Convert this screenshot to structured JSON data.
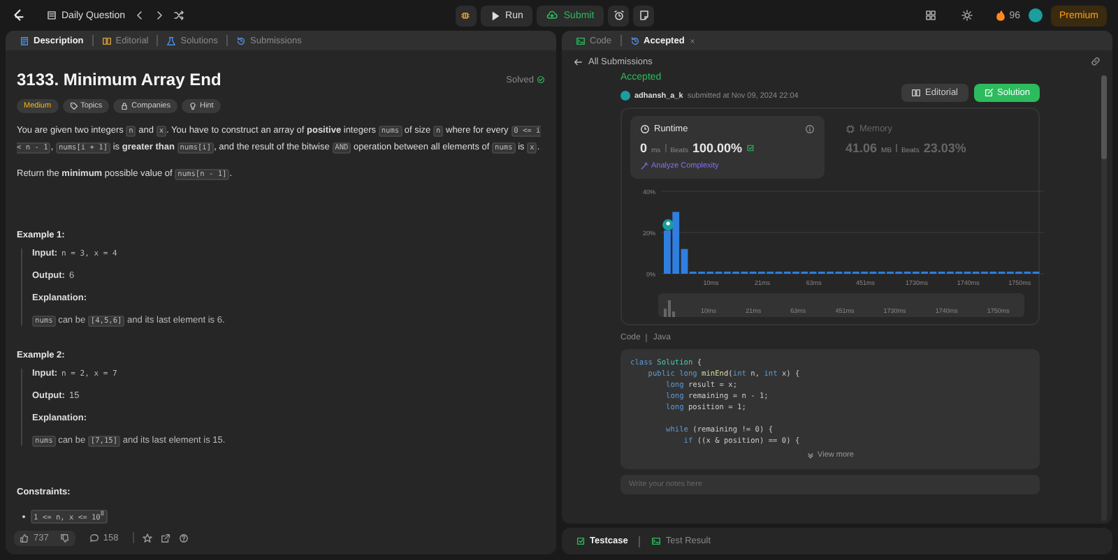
{
  "top_bar": {
    "nav_label": "Daily Question",
    "run_label": "Run",
    "submit_label": "Submit",
    "streak": "96",
    "premium_label": "Premium"
  },
  "left_tabs": [
    {
      "label": "Description",
      "selected": true
    },
    {
      "label": "Editorial",
      "selected": false
    },
    {
      "label": "Solutions",
      "selected": false
    },
    {
      "label": "Submissions",
      "selected": false
    }
  ],
  "problem": {
    "title": "3133. Minimum Array End",
    "status": "Solved",
    "tags": [
      {
        "label": "Medium",
        "kind": "difficulty"
      },
      {
        "label": "Topics",
        "kind": "topics"
      },
      {
        "label": "Companies",
        "kind": "companies"
      },
      {
        "label": "Hint",
        "kind": "hint"
      }
    ],
    "paragraphs": [
      [
        {
          "kind": "text",
          "text": "You are given two integers "
        },
        {
          "kind": "code",
          "text": "n"
        },
        {
          "kind": "text",
          "text": " and "
        },
        {
          "kind": "code",
          "text": "x"
        },
        {
          "kind": "text",
          "text": ". You have to construct an array of "
        },
        {
          "kind": "bold",
          "text": "positive"
        },
        {
          "kind": "text",
          "text": " integers "
        },
        {
          "kind": "code",
          "text": "nums"
        },
        {
          "kind": "text",
          "text": " of size "
        },
        {
          "kind": "code",
          "text": "n"
        },
        {
          "kind": "text",
          "text": " where for every "
        },
        {
          "kind": "code",
          "text": "0 <= i < n - 1"
        },
        {
          "kind": "text",
          "text": ", "
        },
        {
          "kind": "code",
          "text": "nums[i + 1]"
        },
        {
          "kind": "text",
          "text": " is "
        },
        {
          "kind": "bold",
          "text": "greater than "
        },
        {
          "kind": "code",
          "text": "nums[i]"
        },
        {
          "kind": "text",
          "text": ", and the result of the bitwise "
        },
        {
          "kind": "code",
          "text": "AND"
        },
        {
          "kind": "text",
          "text": " operation between all elements of "
        },
        {
          "kind": "code",
          "text": "nums"
        },
        {
          "kind": "text",
          "text": " is "
        },
        {
          "kind": "code",
          "text": "x"
        },
        {
          "kind": "text",
          "text": "."
        }
      ],
      [
        {
          "kind": "text",
          "text": "Return the "
        },
        {
          "kind": "bold",
          "text": "minimum"
        },
        {
          "kind": "text",
          "text": " possible value of "
        },
        {
          "kind": "code",
          "text": "nums[n - 1]"
        },
        {
          "kind": "text",
          "text": "."
        }
      ]
    ],
    "examples": [
      {
        "title": "Example 1:",
        "input_label": "Input:",
        "input": "n = 3, x = 4",
        "output_label": "Output:",
        "output": "6",
        "explanation_label": "Explanation:",
        "explanation": [
          {
            "kind": "code",
            "text": "nums"
          },
          {
            "kind": "text",
            "text": " can be "
          },
          {
            "kind": "code",
            "text": "[4,5,6]"
          },
          {
            "kind": "text",
            "text": " and its last element is 6."
          }
        ]
      },
      {
        "title": "Example 2:",
        "input_label": "Input:",
        "input": "n = 2, x = 7",
        "output_label": "Output:",
        "output": "15",
        "explanation_label": "Explanation:",
        "explanation": [
          {
            "kind": "code",
            "text": "nums"
          },
          {
            "kind": "text",
            "text": " can be "
          },
          {
            "kind": "code",
            "text": "[7,15]"
          },
          {
            "kind": "text",
            "text": " and its last element is 15."
          }
        ]
      }
    ],
    "constraints_title": "Constraints:",
    "constraints": [
      "1 <= n, x <= 10$^{8}$"
    ]
  },
  "left_footer": {
    "likes": "737",
    "comments": "158"
  },
  "right_tabs": [
    {
      "label": "Code",
      "selected": false,
      "closable": false
    },
    {
      "label": "Accepted",
      "selected": true,
      "closable": true
    }
  ],
  "submission": {
    "back_label": "All Submissions",
    "status": "Accepted",
    "user": "adhansh_a_k",
    "submitted": "submitted at Nov 09, 2024 22:04",
    "editorial_button": "Editorial",
    "solution_button": "Solution",
    "metrics": [
      {
        "kind": "runtime",
        "label": "Runtime",
        "value": "0",
        "unit": "ms",
        "beats_label": "Beats",
        "beats": "100.00%",
        "selected": true,
        "link": "Analyze Complexity"
      },
      {
        "kind": "memory",
        "label": "Memory",
        "value": "41.06",
        "unit": "MB",
        "beats_label": "Beats",
        "beats": "23.03%",
        "selected": false
      }
    ],
    "chart_data": {
      "type": "bar",
      "categories": [
        null,
        null,
        null,
        null,
        null,
        "10ms",
        null,
        null,
        null,
        null,
        null,
        "21ms",
        null,
        null,
        null,
        null,
        null,
        "63ms",
        null,
        null,
        null,
        null,
        null,
        "451ms",
        null,
        null,
        null,
        null,
        null,
        "1730ms",
        null,
        null,
        null,
        null,
        null,
        "1740ms",
        null,
        null,
        null,
        null,
        null,
        "1750ms",
        null,
        null
      ],
      "values": [
        21,
        30,
        12,
        1,
        1,
        1,
        1,
        1,
        1,
        1,
        1,
        1,
        1,
        1,
        1,
        1,
        1,
        1,
        1,
        1,
        1,
        1,
        1,
        1,
        1,
        1,
        1,
        1,
        1,
        1,
        1,
        1,
        1,
        1,
        1,
        1,
        1,
        1,
        1,
        1,
        1,
        1,
        1,
        1
      ],
      "ylim": [
        0,
        40
      ],
      "yticks": [
        {
          "value": 0,
          "label": "0%"
        },
        {
          "value": 20,
          "label": "20%"
        },
        {
          "value": 40,
          "label": "40%"
        }
      ]
    },
    "overview_labels": [
      "10ms",
      "21ms",
      "63ms",
      "451ms",
      "1730ms",
      "1740ms",
      "1750ms"
    ],
    "code_label": "Code",
    "language": "Java",
    "code_lines": [
      {
        "gap_before": false,
        "tokens": [
          {
            "kind": "keyword",
            "text": "class "
          },
          {
            "kind": "type",
            "text": "Solution"
          },
          {
            "kind": "plain",
            "text": " {"
          }
        ]
      },
      {
        "gap_before": false,
        "tokens": [
          {
            "kind": "keyword",
            "text": "    public long "
          },
          {
            "kind": "function",
            "text": "minEnd"
          },
          {
            "kind": "plain",
            "text": "("
          },
          {
            "kind": "keyword",
            "text": "int "
          },
          {
            "kind": "plain",
            "text": "n, "
          },
          {
            "kind": "keyword",
            "text": "int "
          },
          {
            "kind": "plain",
            "text": "x) {"
          }
        ]
      },
      {
        "gap_before": false,
        "tokens": [
          {
            "kind": "keyword",
            "text": "        long "
          },
          {
            "kind": "plain",
            "text": "result = x;"
          }
        ]
      },
      {
        "gap_before": false,
        "tokens": [
          {
            "kind": "keyword",
            "text": "        long "
          },
          {
            "kind": "plain",
            "text": "remaining = n - 1;"
          }
        ]
      },
      {
        "gap_before": false,
        "tokens": [
          {
            "kind": "keyword",
            "text": "        long "
          },
          {
            "kind": "plain",
            "text": "position = 1;"
          }
        ]
      },
      {
        "gap_before": true,
        "tokens": [
          {
            "kind": "keyword",
            "text": "        while "
          },
          {
            "kind": "plain",
            "text": "(remaining != 0) {"
          }
        ]
      },
      {
        "gap_before": false,
        "tokens": [
          {
            "kind": "keyword",
            "text": "            if "
          },
          {
            "kind": "plain",
            "text": "((x & position) == 0) {"
          }
        ]
      }
    ],
    "view_more": "View more",
    "notes_placeholder": "Write your notes here"
  },
  "bottom_tabs": [
    {
      "label": "Testcase",
      "selected": true
    },
    {
      "label": "Test Result",
      "selected": false
    }
  ]
}
